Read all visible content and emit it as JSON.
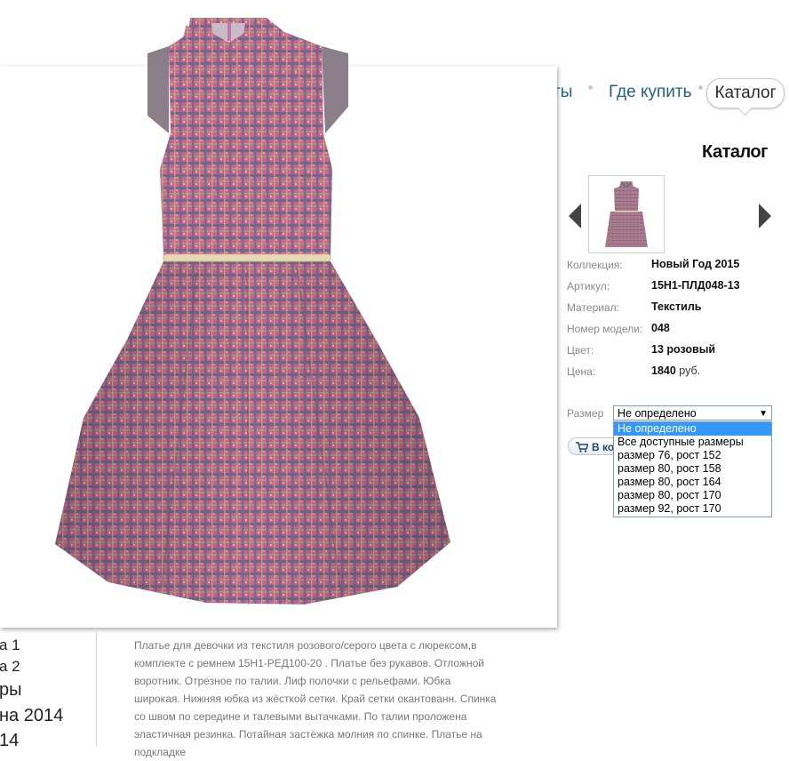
{
  "nav": {
    "items": [
      {
        "label": "ты"
      },
      {
        "label": "Где купить"
      }
    ],
    "active_label": "Каталог"
  },
  "page": {
    "heading": "Каталог"
  },
  "product": {
    "fields": [
      {
        "label": "Коллекция:",
        "value": "Новый Год 2015"
      },
      {
        "label": "Артикул:",
        "value": "15Н1-ПЛД048-13"
      },
      {
        "label": "Материал:",
        "value": "Текстиль"
      },
      {
        "label": "Номер модели:",
        "value": "048"
      },
      {
        "label": "Цвет:",
        "value": "13 розовый"
      },
      {
        "label": "Цена:",
        "value": "1840",
        "unit": "руб."
      }
    ],
    "size": {
      "label": "Размер",
      "selected": "Не определено",
      "options": [
        "Не определено",
        "Все доступные размеры",
        "размер 76, рост 152",
        "размер 80, рост 158",
        "размер 80, рост 164",
        "размер 80, рост 170",
        "размер 92, рост 170"
      ]
    },
    "cart_button_label": "В корзину",
    "description": "Платье для девочки из текстиля розового/серого цвета с люрексом,в комплекте с ремнем 15Н1-РЕД100-20 . Платье без рукавов. Отложной воротник. Отрезное по талии. Лиф полочки с рельефами. Юбка широкая. Нижняя юбка из жёсткой сетки. Край сетки окантованн. Спинка со швом по середине и талевыми вытачками. По талии проложена эластичная резинка. Потайная застёжка молния по спинке. Платье на подкладке"
  },
  "sidebar": {
    "items": [
      "а 1",
      "а 2",
      "ры",
      "на 2014",
      "14"
    ]
  },
  "colors": {
    "nav_link": "#23627f",
    "dress_pink": "#d55aa0",
    "dress_gray": "#6c6f80",
    "select_highlight": "#3399ff"
  },
  "icons": {
    "thumb": "dress-thumbnail",
    "left_arrow": "arrow-left-icon",
    "right_arrow": "arrow-right-icon",
    "cart": "cart-icon"
  }
}
